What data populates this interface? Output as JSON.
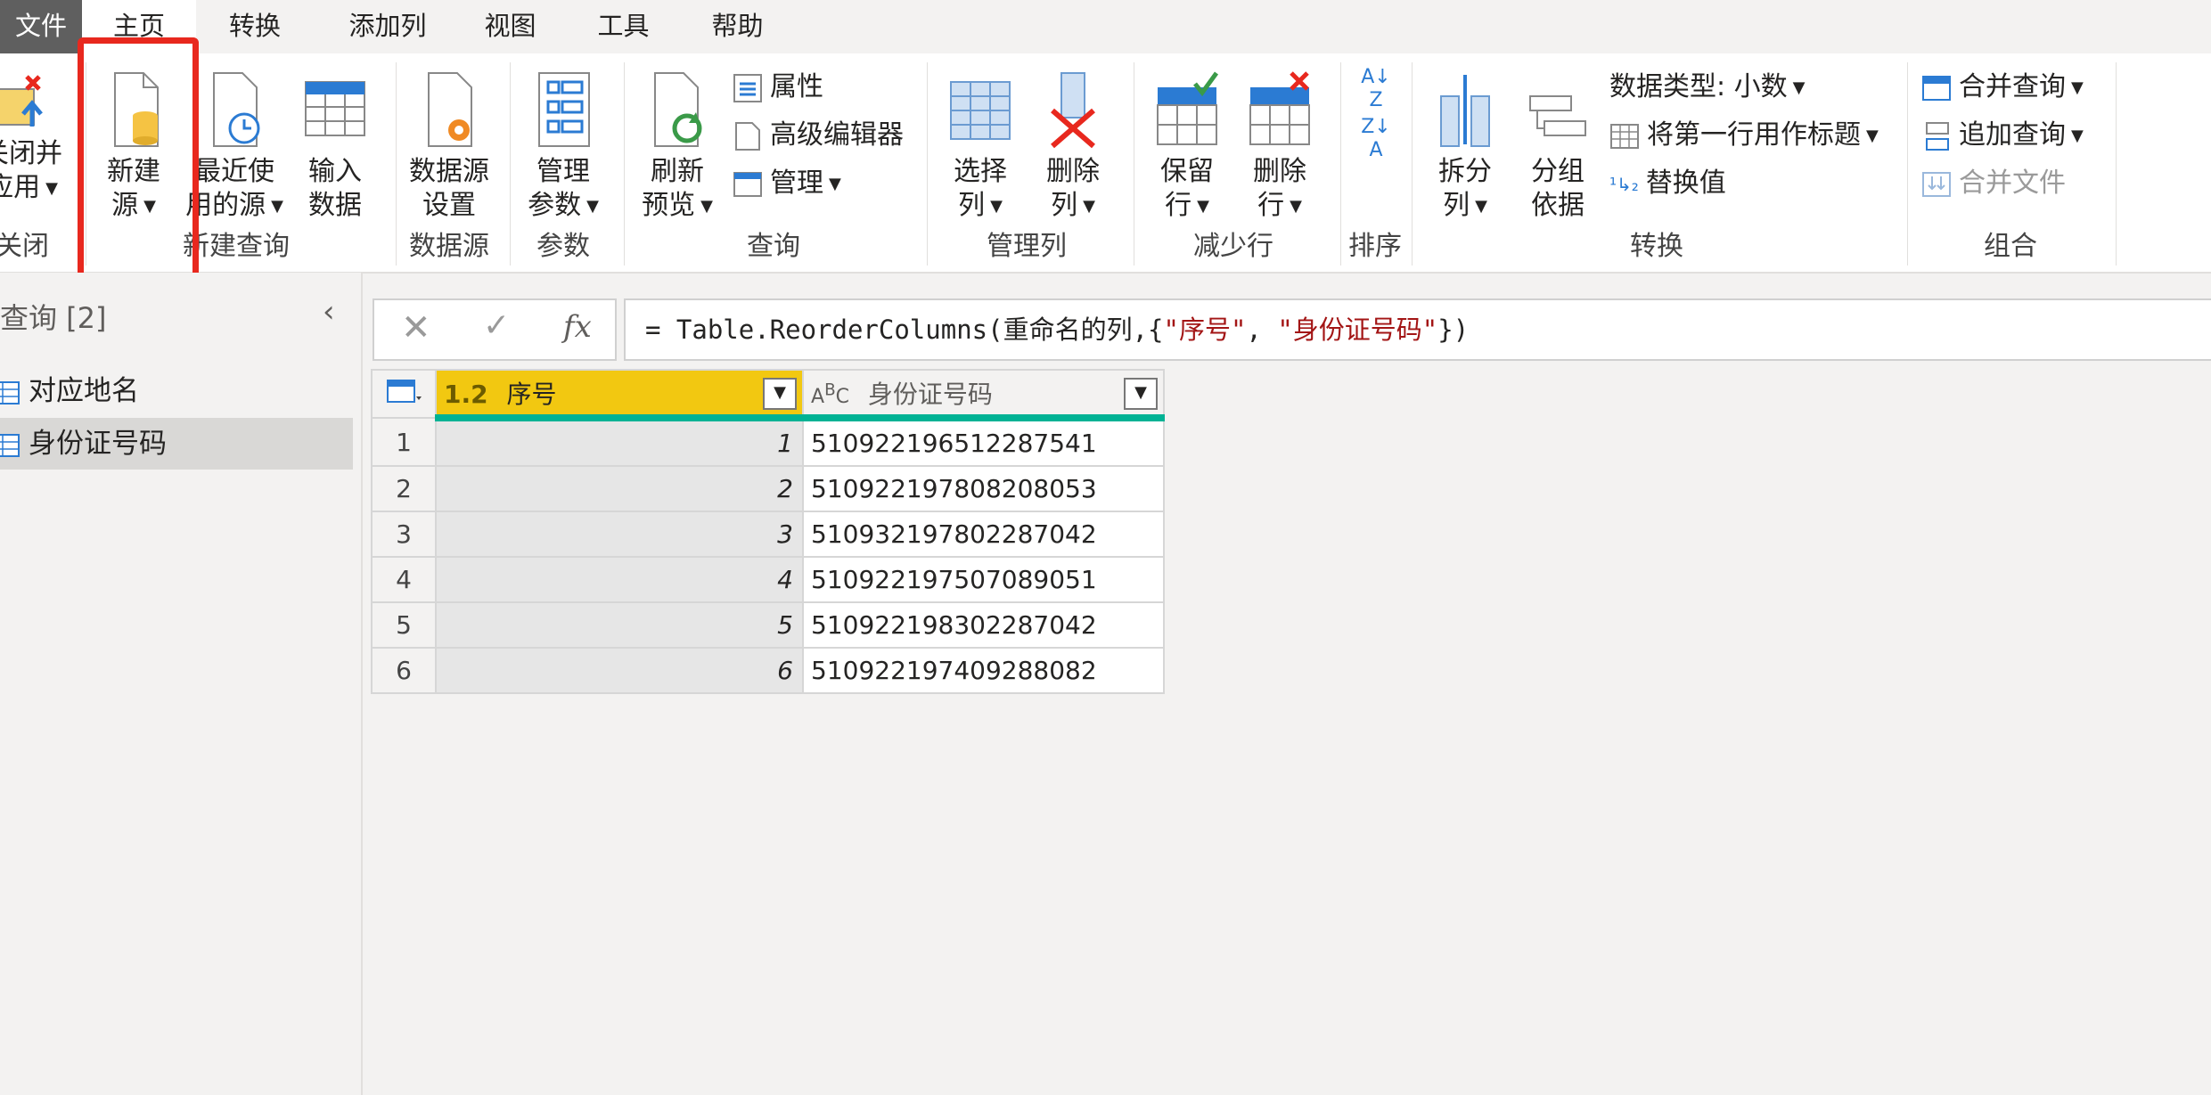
{
  "tabs": [
    "文件",
    "主页",
    "转换",
    "添加列",
    "视图",
    "工具",
    "帮助"
  ],
  "ribbon": {
    "close_apply": {
      "line1": "关闭并",
      "line2": "应用",
      "group": "关闭"
    },
    "new_source": {
      "line1": "新建",
      "line2": "源"
    },
    "recent_sources": {
      "line1": "最近使",
      "line2": "用的源"
    },
    "enter_data": {
      "line1": "输入",
      "line2": "数据"
    },
    "new_query_group": "新建查询",
    "data_source_settings": {
      "line1": "数据源",
      "line2": "设置"
    },
    "data_source_group": "数据源",
    "manage_params": {
      "line1": "管理",
      "line2": "参数"
    },
    "params_group": "参数",
    "refresh_preview": {
      "line1": "刷新",
      "line2": "预览"
    },
    "properties": "属性",
    "advanced_editor": "高级编辑器",
    "manage": "管理",
    "query_group": "查询",
    "choose_columns": {
      "line1": "选择",
      "line2": "列"
    },
    "remove_columns": {
      "line1": "删除",
      "line2": "列"
    },
    "manage_columns_group": "管理列",
    "keep_rows": {
      "line1": "保留",
      "line2": "行"
    },
    "remove_rows": {
      "line1": "删除",
      "line2": "行"
    },
    "reduce_rows_group": "减少行",
    "sort_group": "排序",
    "split_column": {
      "line1": "拆分",
      "line2": "列"
    },
    "group_by": {
      "line1": "分组",
      "line2": "依据"
    },
    "data_type": "数据类型: 小数",
    "use_first_row": "将第一行用作标题",
    "replace_values": "替换值",
    "transform_group": "转换",
    "merge_queries": "合并查询",
    "append_queries": "追加查询",
    "combine_files": "合并文件",
    "combine_group": "组合"
  },
  "queries": {
    "title": "查询 [2]",
    "items": [
      "对应地名",
      "身份证号码"
    ]
  },
  "formula": {
    "prefix": "= Table.ReorderColumns(重命名的列,{",
    "s1": "\"序号\"",
    "mid": ", ",
    "s2": "\"身份证号码\"",
    "suffix": "})"
  },
  "grid": {
    "col1": {
      "type": "1.2",
      "name": "序号"
    },
    "col2": {
      "type": "ABC",
      "name": "身份证号码"
    },
    "rows": [
      {
        "n": "1",
        "seq": "1",
        "id": "510922196512287541"
      },
      {
        "n": "2",
        "seq": "2",
        "id": "510922197808208053"
      },
      {
        "n": "3",
        "seq": "3",
        "id": "510932197802287042"
      },
      {
        "n": "4",
        "seq": "4",
        "id": "510922197507089051"
      },
      {
        "n": "5",
        "seq": "5",
        "id": "510922198302287042"
      },
      {
        "n": "6",
        "seq": "6",
        "id": "510922197409288082"
      }
    ]
  },
  "colors": {
    "accent_header": "#f2c811",
    "teal_bar": "#00b294",
    "highlight": "#e8281e"
  }
}
